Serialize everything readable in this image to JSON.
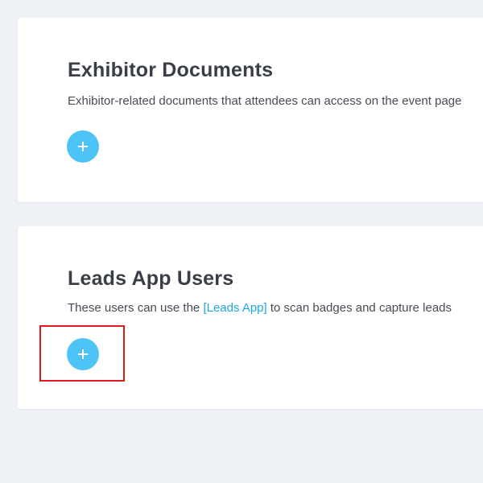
{
  "sections": {
    "documents": {
      "title": "Exhibitor Documents",
      "description": "Exhibitor-related documents that attendees can access on the event page"
    },
    "leads": {
      "title": "Leads App Users",
      "description_before": "These users can use the ",
      "link_label": "[Leads App]",
      "description_after": " to scan badges and capture leads"
    }
  },
  "colors": {
    "background": "#eef1f6",
    "card": "#ffffff",
    "add_button": "#4ec3f5",
    "link": "#1ea7e4",
    "highlight": "#e3161b"
  },
  "icons": {
    "add": "plus-icon"
  }
}
